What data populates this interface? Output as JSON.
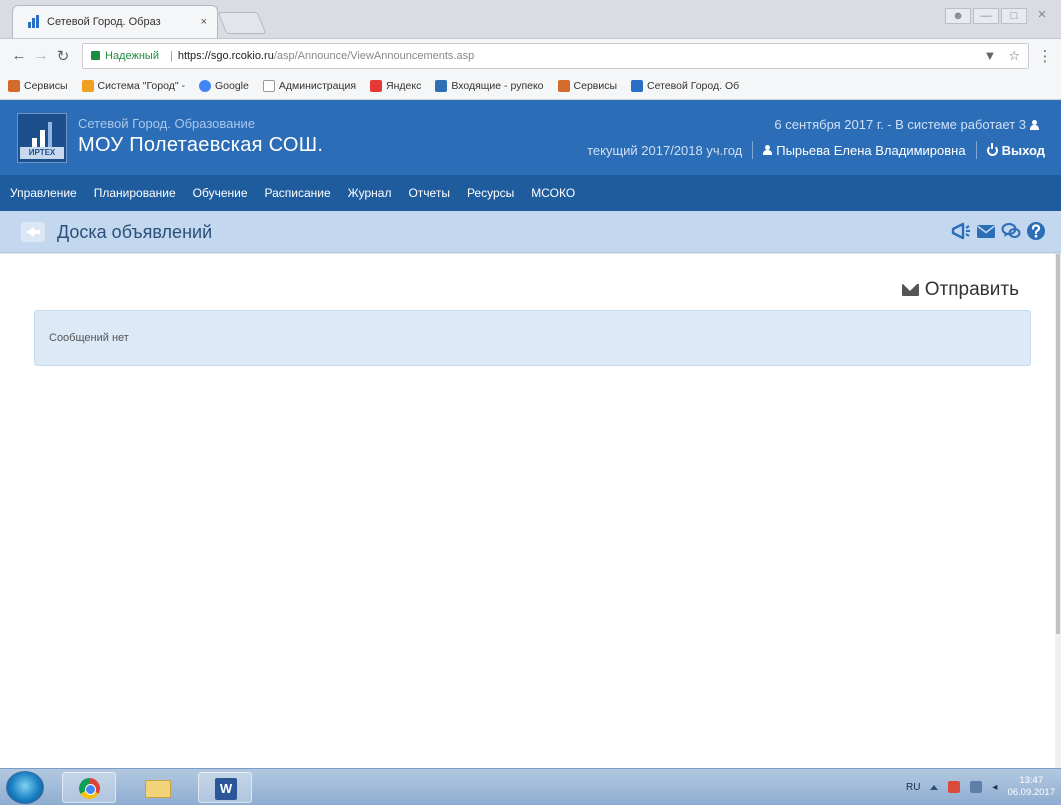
{
  "browser": {
    "tab_title": "Сетевой Город. Образ",
    "tab_close": "×",
    "secure_label": "Надежный",
    "url_host": "https://sgo.rcokio.ru",
    "url_path": "/asp/Announce/ViewAnnouncements.asp",
    "bookmarks": [
      {
        "label": "Сервисы",
        "color": "#d46b2a"
      },
      {
        "label": "Система \"Город\" - ",
        "color": "#f0a020"
      },
      {
        "label": "Google",
        "color": "#4285f4"
      },
      {
        "label": "Администрация",
        "color": "#cccccc"
      },
      {
        "label": "Яндекс",
        "color": "#e53935"
      },
      {
        "label": "Входящие - рупеко",
        "color": "#2f6fb6"
      },
      {
        "label": "Сервисы",
        "color": "#d46b2a"
      },
      {
        "label": "Сетевой Город. Об",
        "color": "#2a6ec4"
      }
    ]
  },
  "header": {
    "system_name": "Сетевой Город. Образование",
    "school_name": "МОУ Полетаевская СОШ.",
    "logo_text": "ИРТЕХ",
    "date_online": "6 сентября 2017 г. - В системе работает 3",
    "school_year": "текущий 2017/2018 уч.год",
    "user_name": "Пырьева Елена Владимировна",
    "logout": "Выход"
  },
  "menu": [
    "Управление",
    "Планирование",
    "Обучение",
    "Расписание",
    "Журнал",
    "Отчеты",
    "Ресурсы",
    "МСОКО"
  ],
  "page": {
    "title": "Доска объявлений",
    "send_label": "Отправить",
    "empty_message": "Сообщений нет"
  },
  "taskbar": {
    "lang": "RU",
    "time": "13:47",
    "date": "06.09.2017"
  }
}
